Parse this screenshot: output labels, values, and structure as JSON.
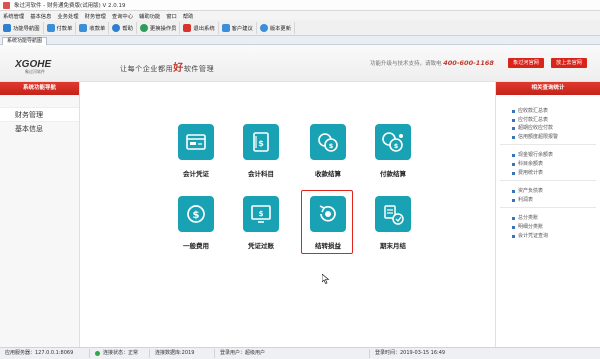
{
  "window": {
    "title": "象过河软件 - 财务通免费版(试用版)  V 2.0.19"
  },
  "menubar": [
    "系统管理",
    "基本信息",
    "业务处理",
    "财务管理",
    "查询中心",
    "辅助功能",
    "窗口",
    "帮助"
  ],
  "toolbar": {
    "buttons": [
      {
        "label": "功能导航图",
        "color": "#2f7fd0"
      },
      {
        "label": "付款单",
        "color": "#3a8fd8"
      },
      {
        "label": "收款单",
        "color": "#3a8fd8"
      },
      {
        "label": "帮助",
        "color": "#2f7fd0"
      },
      {
        "label": "更换操作员",
        "color": "#2e9d5b"
      },
      {
        "label": "退出系统",
        "color": "#d9342b"
      },
      {
        "label": "客户建议",
        "color": "#3a8fd8"
      },
      {
        "label": "版本更新",
        "color": "#3a8fd8"
      }
    ]
  },
  "tabs": {
    "active": "系统功能导航图"
  },
  "brand": {
    "logo_text": "XGOHE",
    "logo_sub": "象过河软件",
    "slogan_pre": "让每个企业都用",
    "slogan_big": "好",
    "slogan_post": "软件管理",
    "support_text": "功能升级与技术支持，请致电",
    "phone": "400-600-1168",
    "btn_site": "象过河官网",
    "btn_home": "放上去官网"
  },
  "left_panel": {
    "header": "系统功能导航",
    "items": [
      "财务管理",
      "基本信息"
    ]
  },
  "right_panel": {
    "header": "相关查询统计",
    "groups": [
      [
        "应收款汇总表",
        "应付款汇总表",
        "超期应收应付款",
        "信用额度超限报警"
      ],
      [
        "现金银行余额表",
        "科目余额表",
        "费用统计表"
      ],
      [
        "资产负债表",
        "利润表"
      ],
      [
        "总分类账",
        "明细分类账",
        "会计凭证查询"
      ]
    ]
  },
  "tiles": [
    {
      "label": "会计凭证",
      "icon": "voucher-icon"
    },
    {
      "label": "会计科目",
      "icon": "account-book-icon"
    },
    {
      "label": "收款结算",
      "icon": "coins-in-icon"
    },
    {
      "label": "付款结算",
      "icon": "coins-out-icon"
    },
    {
      "label": "一般费用",
      "icon": "dollar-coin-icon"
    },
    {
      "label": "凭证过账",
      "icon": "screen-transfer-icon"
    },
    {
      "label": "结转损益",
      "icon": "rotate-coin-icon"
    },
    {
      "label": "期末月结",
      "icon": "month-close-icon"
    }
  ],
  "highlighted_tile": "结转损益",
  "statusbar": {
    "server": "应用服务器：127.0.0.1:8069",
    "connection": "连接状态：正常",
    "conn_color": "#2ea84a",
    "db": "连接数据库:2019",
    "login": "登录用户：超级用户",
    "login_time": "登录时间：2019-03-15 16:49"
  }
}
